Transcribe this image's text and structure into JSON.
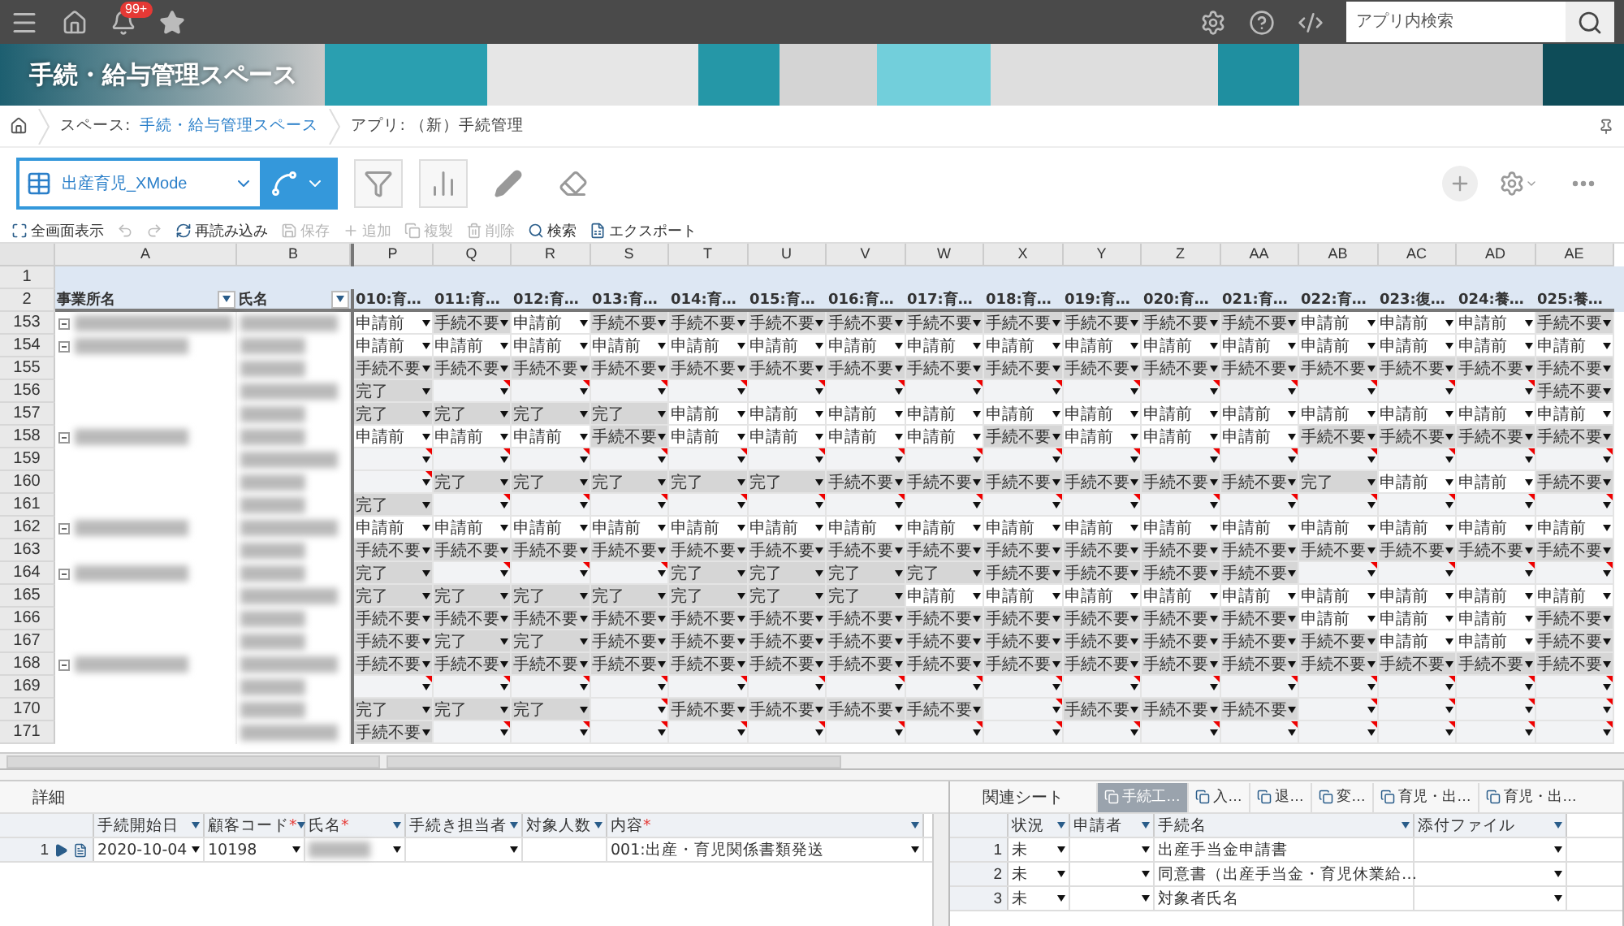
{
  "topbar": {
    "badge": "99+",
    "search": {
      "placeholder": "アプリ内検索"
    }
  },
  "banner": {
    "title": "手続・給与管理スペース"
  },
  "breadcrumb": {
    "space_label": "スペース:",
    "space_link": "手続・給与管理スペース",
    "app": "アプリ: （新）手続管理"
  },
  "view": {
    "name": "出産育児_XMode"
  },
  "actions": [
    {
      "kind": "fullscreen",
      "label": "全画面表示",
      "disabled": false
    },
    {
      "kind": "undo",
      "disabled": true
    },
    {
      "kind": "redo",
      "disabled": true
    },
    {
      "kind": "reload",
      "label": "再読み込み",
      "disabled": false
    },
    {
      "kind": "save",
      "label": "保存",
      "disabled": true
    },
    {
      "kind": "add",
      "label": "追加",
      "disabled": true
    },
    {
      "kind": "copy",
      "label": "複製",
      "disabled": true
    },
    {
      "kind": "delete",
      "label": "削除",
      "disabled": true
    },
    {
      "kind": "search",
      "label": "検索",
      "disabled": false
    },
    {
      "kind": "export",
      "label": "エクスポート",
      "disabled": false
    }
  ],
  "sheet": {
    "letters": [
      "A",
      "B",
      "P",
      "Q",
      "R",
      "S",
      "T",
      "U",
      "V",
      "W",
      "X",
      "Y",
      "Z",
      "AA",
      "AB",
      "AC",
      "AD",
      "AE"
    ],
    "header_rows": [
      "1",
      "2"
    ],
    "fields": [
      {
        "label": "事業所名",
        "filter": true
      },
      {
        "label": "氏名",
        "filter": true
      },
      {
        "label": "010:育…",
        "filter": false
      },
      {
        "label": "011:育…",
        "filter": false
      },
      {
        "label": "012:育…",
        "filter": false
      },
      {
        "label": "013:育…",
        "filter": false
      },
      {
        "label": "014:育…",
        "filter": false
      },
      {
        "label": "015:育…",
        "filter": false
      },
      {
        "label": "016:育…",
        "filter": false
      },
      {
        "label": "017:育…",
        "filter": false
      },
      {
        "label": "018:育…",
        "filter": false
      },
      {
        "label": "019:育…",
        "filter": false
      },
      {
        "label": "020:育…",
        "filter": false
      },
      {
        "label": "021:育…",
        "filter": false
      },
      {
        "label": "022:育…",
        "filter": false
      },
      {
        "label": "023:復…",
        "filter": false
      },
      {
        "label": "024:養…",
        "filter": false
      },
      {
        "label": "025:養…",
        "filter": false
      }
    ],
    "rows": [
      {
        "num": "153",
        "group": true,
        "cells": [
          "申請前",
          "手続不要",
          "申請前",
          "手続不要",
          "手続不要",
          "手続不要",
          "手続不要",
          "手続不要",
          "手続不要",
          "手続不要",
          "手続不要",
          "手続不要",
          "申請前",
          "申請前",
          "申請前",
          "手続不要"
        ],
        "shaded": [
          false,
          true,
          false,
          true,
          true,
          true,
          true,
          true,
          true,
          true,
          true,
          true,
          false,
          false,
          false,
          true
        ]
      },
      {
        "num": "154",
        "group": true,
        "cells": [
          "申請前",
          "申請前",
          "申請前",
          "申請前",
          "申請前",
          "申請前",
          "申請前",
          "申請前",
          "申請前",
          "申請前",
          "申請前",
          "申請前",
          "申請前",
          "申請前",
          "申請前",
          "申請前"
        ],
        "shaded": [
          false,
          false,
          false,
          false,
          false,
          false,
          false,
          false,
          false,
          false,
          false,
          false,
          false,
          false,
          false,
          false
        ]
      },
      {
        "num": "155",
        "group": false,
        "cells": [
          "手続不要",
          "手続不要",
          "手続不要",
          "手続不要",
          "手続不要",
          "手続不要",
          "手続不要",
          "手続不要",
          "手続不要",
          "手続不要",
          "手続不要",
          "手続不要",
          "手続不要",
          "手続不要",
          "手続不要",
          "手続不要"
        ],
        "shaded": [
          true,
          true,
          true,
          true,
          true,
          true,
          true,
          true,
          true,
          true,
          true,
          true,
          true,
          true,
          true,
          true
        ]
      },
      {
        "num": "156",
        "group": false,
        "cells": [
          "完了",
          null,
          null,
          null,
          null,
          null,
          null,
          null,
          null,
          null,
          null,
          null,
          null,
          null,
          null,
          "手続不要"
        ],
        "shaded": [
          true,
          false,
          false,
          false,
          false,
          false,
          false,
          false,
          false,
          false,
          false,
          false,
          false,
          false,
          false,
          true
        ]
      },
      {
        "num": "157",
        "group": false,
        "cells": [
          "完了",
          "完了",
          "完了",
          "完了",
          "申請前",
          "申請前",
          "申請前",
          "申請前",
          "申請前",
          "申請前",
          "申請前",
          "申請前",
          "申請前",
          "申請前",
          "申請前",
          "申請前"
        ],
        "shaded": [
          true,
          true,
          true,
          true,
          false,
          false,
          false,
          false,
          false,
          false,
          false,
          false,
          false,
          false,
          false,
          false
        ]
      },
      {
        "num": "158",
        "group": true,
        "cells": [
          "申請前",
          "申請前",
          "申請前",
          "手続不要",
          "申請前",
          "申請前",
          "申請前",
          "申請前",
          "手続不要",
          "申請前",
          "申請前",
          "申請前",
          "手続不要",
          "手続不要",
          "手続不要",
          "手続不要"
        ],
        "shaded": [
          false,
          false,
          false,
          true,
          false,
          false,
          false,
          false,
          true,
          false,
          false,
          false,
          true,
          true,
          true,
          true
        ]
      },
      {
        "num": "159",
        "group": false,
        "cells": [
          null,
          null,
          null,
          null,
          null,
          null,
          null,
          null,
          null,
          null,
          null,
          null,
          null,
          null,
          null,
          null
        ],
        "shaded": [
          false,
          false,
          false,
          false,
          false,
          false,
          false,
          false,
          false,
          false,
          false,
          false,
          false,
          false,
          false,
          false
        ]
      },
      {
        "num": "160",
        "group": false,
        "cells": [
          null,
          "完了",
          "完了",
          "完了",
          "完了",
          "完了",
          "手続不要",
          "手続不要",
          "手続不要",
          "手続不要",
          "手続不要",
          "手続不要",
          "完了",
          "申請前",
          "申請前",
          "手続不要"
        ],
        "shaded": [
          false,
          true,
          true,
          true,
          true,
          true,
          true,
          true,
          true,
          true,
          true,
          true,
          true,
          false,
          false,
          true
        ]
      },
      {
        "num": "161",
        "group": false,
        "cells": [
          "完了",
          null,
          null,
          null,
          null,
          null,
          null,
          null,
          null,
          null,
          null,
          null,
          null,
          null,
          null,
          null
        ],
        "shaded": [
          true,
          false,
          false,
          false,
          false,
          false,
          false,
          false,
          false,
          false,
          false,
          false,
          false,
          false,
          false,
          false
        ]
      },
      {
        "num": "162",
        "group": true,
        "cells": [
          "申請前",
          "申請前",
          "申請前",
          "申請前",
          "申請前",
          "申請前",
          "申請前",
          "申請前",
          "申請前",
          "申請前",
          "申請前",
          "申請前",
          "申請前",
          "申請前",
          "申請前",
          "申請前"
        ],
        "shaded": [
          false,
          false,
          false,
          false,
          false,
          false,
          false,
          false,
          false,
          false,
          false,
          false,
          false,
          false,
          false,
          false
        ]
      },
      {
        "num": "163",
        "group": false,
        "cells": [
          "手続不要",
          "手続不要",
          "手続不要",
          "手続不要",
          "手続不要",
          "手続不要",
          "手続不要",
          "手続不要",
          "手続不要",
          "手続不要",
          "手続不要",
          "手続不要",
          "手続不要",
          "手続不要",
          "手続不要",
          "手続不要"
        ],
        "shaded": [
          true,
          true,
          true,
          true,
          true,
          true,
          true,
          true,
          true,
          true,
          true,
          true,
          true,
          true,
          true,
          true
        ]
      },
      {
        "num": "164",
        "group": true,
        "cells": [
          "完了",
          null,
          null,
          null,
          "完了",
          "完了",
          "完了",
          "完了",
          "手続不要",
          "手続不要",
          "手続不要",
          "手続不要",
          null,
          null,
          null,
          null
        ],
        "shaded": [
          true,
          false,
          false,
          false,
          true,
          true,
          true,
          true,
          true,
          true,
          true,
          true,
          false,
          false,
          false,
          false
        ]
      },
      {
        "num": "165",
        "group": false,
        "cells": [
          "完了",
          "完了",
          "完了",
          "完了",
          "完了",
          "完了",
          "完了",
          "申請前",
          "申請前",
          "申請前",
          "申請前",
          "申請前",
          "申請前",
          "申請前",
          "申請前",
          "申請前"
        ],
        "shaded": [
          true,
          true,
          true,
          true,
          true,
          true,
          true,
          false,
          false,
          false,
          false,
          false,
          false,
          false,
          false,
          false
        ]
      },
      {
        "num": "166",
        "group": false,
        "cells": [
          "手続不要",
          "手続不要",
          "手続不要",
          "手続不要",
          "手続不要",
          "手続不要",
          "手続不要",
          "手続不要",
          "手続不要",
          "手続不要",
          "手続不要",
          "手続不要",
          "申請前",
          "申請前",
          "申請前",
          "手続不要"
        ],
        "shaded": [
          true,
          true,
          true,
          true,
          true,
          true,
          true,
          true,
          true,
          true,
          true,
          true,
          false,
          false,
          false,
          true
        ]
      },
      {
        "num": "167",
        "group": false,
        "cells": [
          "手続不要",
          "完了",
          "完了",
          "手続不要",
          "手続不要",
          "手続不要",
          "手続不要",
          "手続不要",
          "手続不要",
          "手続不要",
          "手続不要",
          "手続不要",
          "手続不要",
          "申請前",
          "申請前",
          "手続不要"
        ],
        "shaded": [
          true,
          true,
          true,
          true,
          true,
          true,
          true,
          true,
          true,
          true,
          true,
          true,
          true,
          false,
          false,
          true
        ]
      },
      {
        "num": "168",
        "group": true,
        "cells": [
          "手続不要",
          "手続不要",
          "手続不要",
          "手続不要",
          "手続不要",
          "手続不要",
          "手続不要",
          "手続不要",
          "手続不要",
          "手続不要",
          "手続不要",
          "手続不要",
          "手続不要",
          "手続不要",
          "手続不要",
          "手続不要"
        ],
        "shaded": [
          true,
          true,
          true,
          true,
          true,
          true,
          true,
          true,
          true,
          true,
          true,
          true,
          true,
          true,
          true,
          true
        ]
      },
      {
        "num": "169",
        "group": false,
        "cells": [
          null,
          null,
          null,
          null,
          null,
          null,
          null,
          null,
          null,
          null,
          null,
          null,
          null,
          null,
          null,
          null
        ],
        "shaded": [
          false,
          false,
          false,
          false,
          false,
          false,
          false,
          false,
          false,
          false,
          false,
          false,
          false,
          false,
          false,
          false
        ]
      },
      {
        "num": "170",
        "group": false,
        "cells": [
          "完了",
          "完了",
          "完了",
          null,
          "手続不要",
          "手続不要",
          "手続不要",
          "手続不要",
          null,
          "手続不要",
          "手続不要",
          "手続不要",
          null,
          null,
          null,
          null
        ],
        "shaded": [
          true,
          true,
          true,
          false,
          true,
          true,
          true,
          true,
          false,
          true,
          true,
          true,
          false,
          false,
          false,
          false
        ]
      },
      {
        "num": "171",
        "group": false,
        "cells": [
          "手続不要",
          null,
          null,
          null,
          null,
          null,
          null,
          null,
          null,
          null,
          null,
          null,
          null,
          null,
          null,
          null
        ],
        "shaded": [
          true,
          false,
          false,
          false,
          false,
          false,
          false,
          false,
          false,
          false,
          false,
          false,
          false,
          false,
          false,
          false
        ]
      }
    ]
  },
  "detail": {
    "title": "詳細",
    "columns": [
      {
        "label": "手続開始日"
      },
      {
        "label": "顧客コード",
        "mark": "*"
      },
      {
        "label": "氏名",
        "mark": "*"
      },
      {
        "label": "手続き担当者"
      },
      {
        "label": "対象人数"
      },
      {
        "label": "内容",
        "mark": "*"
      }
    ],
    "rows": [
      {
        "num": "1",
        "cells": [
          {
            "text": "2020-10-04",
            "dropdown": true
          },
          {
            "text": "10198",
            "dropdown": true
          },
          {
            "blurred": true,
            "dropdown": true
          },
          {
            "dropdown": true
          },
          {
            "dropdown": false
          },
          {
            "text": "001:出産・育児関係書類発送",
            "dropdown": true
          }
        ]
      }
    ]
  },
  "related": {
    "title": "関連シート",
    "tabs": [
      {
        "label": "手続工…",
        "selected": true
      },
      {
        "label": "入…",
        "selected": false
      },
      {
        "label": "退…",
        "selected": false
      },
      {
        "label": "変…",
        "selected": false
      },
      {
        "label": "育児・出…",
        "selected": false
      },
      {
        "label": "育児・出…",
        "selected": false
      }
    ],
    "columns": [
      "状況",
      "申請者",
      "手続名",
      "添付ファイル"
    ],
    "rows": [
      {
        "num": "1",
        "cells": [
          "未",
          null,
          "出産手当金申請書",
          null
        ]
      },
      {
        "num": "2",
        "cells": [
          "未",
          null,
          "同意書（出産手当金・育児休業給…",
          null
        ]
      },
      {
        "num": "3",
        "cells": [
          "未",
          null,
          "対象者氏名",
          null
        ]
      }
    ]
  }
}
